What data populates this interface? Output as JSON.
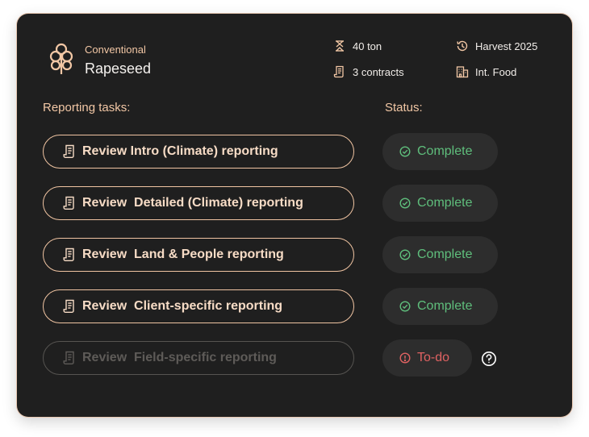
{
  "crop": {
    "type": "Conventional",
    "name": "Rapeseed",
    "icon": "crop-flower-icon"
  },
  "meta": {
    "quantity": "40 ton",
    "harvest": "Harvest 2025",
    "contracts": "3 contracts",
    "buyer": "Int. Food"
  },
  "labels": {
    "tasks": "Reporting tasks:",
    "status": "Status:"
  },
  "tasks": [
    {
      "label": "Review Intro (Climate) reporting",
      "status": "Complete",
      "state": "complete"
    },
    {
      "label": "Review  Detailed (Climate) reporting",
      "status": "Complete",
      "state": "complete"
    },
    {
      "label": "Review  Land & People reporting",
      "status": "Complete",
      "state": "complete"
    },
    {
      "label": "Review  Client-specific reporting",
      "status": "Complete",
      "state": "complete"
    },
    {
      "label": "Review  Field-specific reporting",
      "status": "To-do",
      "state": "todo"
    }
  ],
  "colors": {
    "accent": "#f2c7a5",
    "complete": "#5fbe7c",
    "todo": "#e06262",
    "card_bg": "#1f1f1f"
  }
}
